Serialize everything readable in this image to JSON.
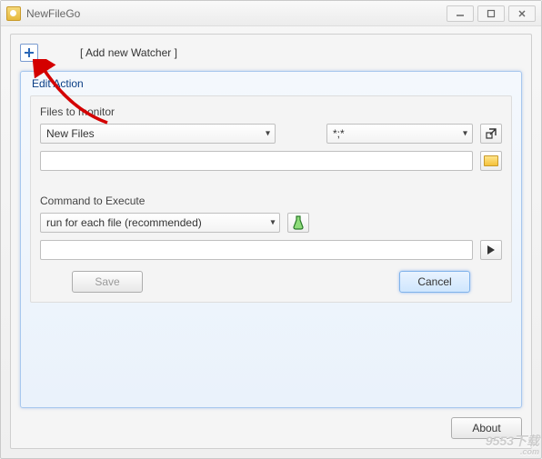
{
  "window": {
    "title": "NewFileGo"
  },
  "watcher": {
    "add_label": "[ Add new Watcher ]"
  },
  "edit_group": {
    "title": "Edit Action"
  },
  "files_section": {
    "title": "Files to monitor",
    "type_combo": "New Files",
    "filter_combo": "*;*",
    "path_value": ""
  },
  "command_section": {
    "title": "Command to Execute",
    "mode_combo": "run for each file  (recommended)",
    "command_value": ""
  },
  "buttons": {
    "save": "Save",
    "cancel": "Cancel",
    "about": "About"
  },
  "watermark": {
    "text": "9553下载",
    "sub": ".com"
  }
}
